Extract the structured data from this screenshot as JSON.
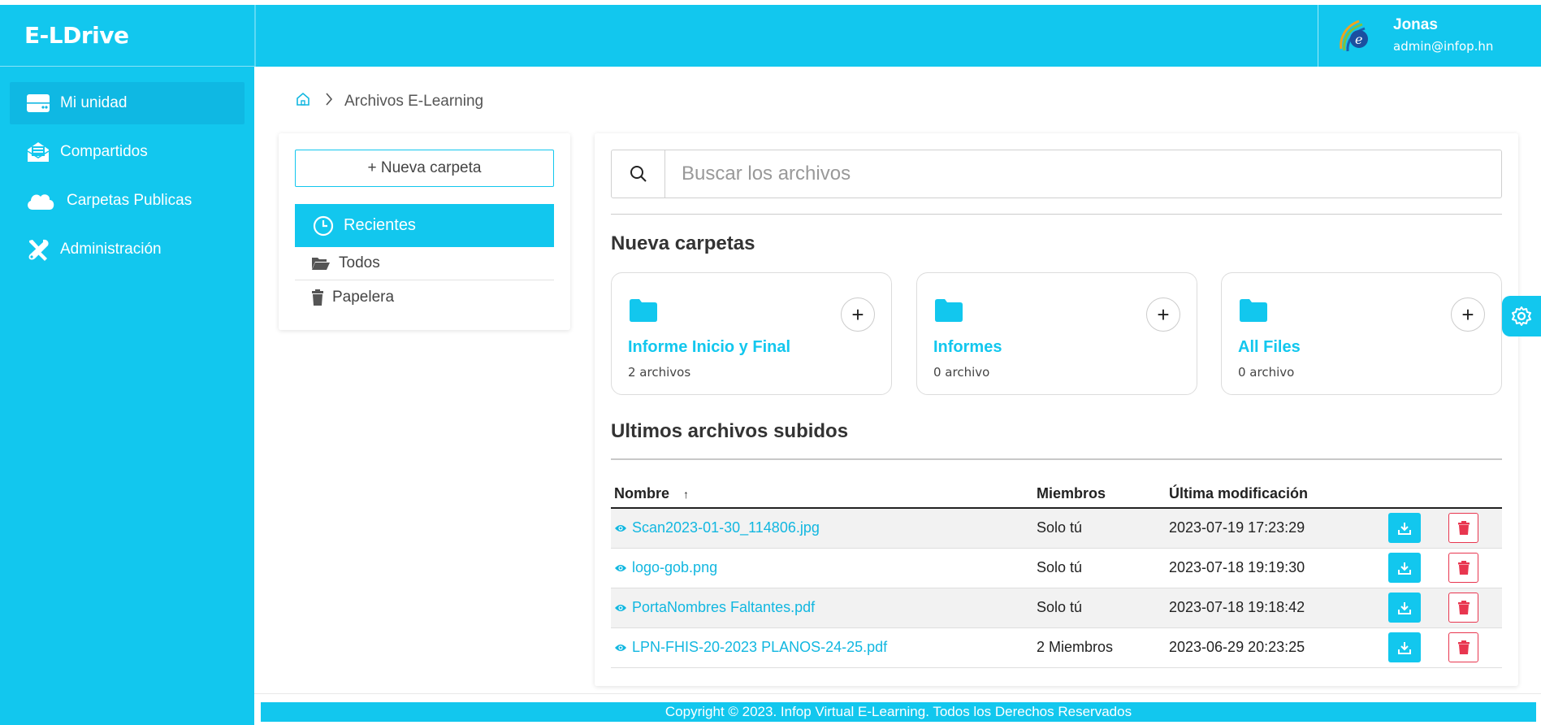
{
  "app": {
    "title": "E-LDrive"
  },
  "sidebar": {
    "items": [
      {
        "label": "Mi unidad",
        "icon": "drive-icon",
        "active": true
      },
      {
        "label": "Compartidos",
        "icon": "shared-mail-icon",
        "active": false
      },
      {
        "label": "Carpetas Publicas",
        "icon": "cloud-icon",
        "active": false
      },
      {
        "label": "Administración",
        "icon": "tools-icon",
        "active": false
      }
    ]
  },
  "header": {
    "user_name": "Jonas",
    "user_email": "admin@infop.hn"
  },
  "breadcrumb": {
    "current": "Archivos E-Learning"
  },
  "left_panel": {
    "new_folder_label": "+ Nueva carpeta",
    "recent_label": "Recientes",
    "all_label": "Todos",
    "trash_label": "Papelera"
  },
  "search": {
    "placeholder": "Buscar los archivos",
    "value": ""
  },
  "folders_section": {
    "title": "Nueva carpetas",
    "cards": [
      {
        "name": "Informe Inicio y Final",
        "count": "2 archivos"
      },
      {
        "name": "Informes",
        "count": "0 archivo"
      },
      {
        "name": "All Files",
        "count": "0 archivo"
      }
    ]
  },
  "files_section": {
    "title": "Ultimos archivos subidos",
    "columns": {
      "name": "Nombre",
      "sort_indicator": "↑",
      "members": "Miembros",
      "modified": "Última modificación"
    },
    "rows": [
      {
        "name": "Scan2023-01-30_114806.jpg",
        "members": "Solo tú",
        "modified": "2023-07-19 17:23:29"
      },
      {
        "name": "logo-gob.png",
        "members": "Solo tú",
        "modified": "2023-07-18 19:19:30"
      },
      {
        "name": "PortaNombres Faltantes.pdf",
        "members": "Solo tú",
        "modified": "2023-07-18 19:18:42"
      },
      {
        "name": "LPN-FHIS-20-2023 PLANOS-24-25.pdf",
        "members": "2 Miembros",
        "modified": "2023-06-29 20:23:25"
      }
    ]
  },
  "footer": {
    "text": "Copyright © 2023. Infop Virtual E-Learning. Todos los Derechos Reservados"
  },
  "colors": {
    "accent": "#12c7ee",
    "danger": "#e8364f"
  }
}
